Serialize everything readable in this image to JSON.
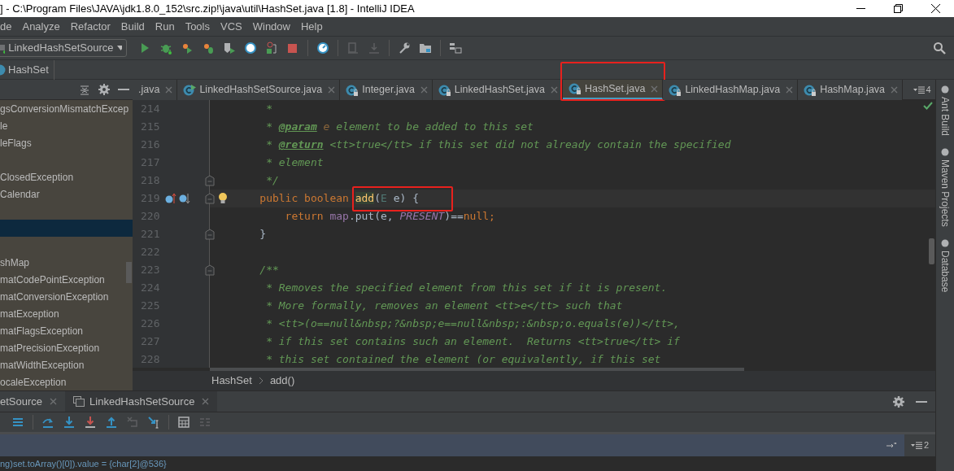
{
  "window": {
    "title": "] - C:\\Program Files\\JAVA\\jdk1.8.0_152\\src.zip!\\java\\util\\HashSet.java [1.8] - IntelliJ IDEA"
  },
  "menu": [
    "de",
    "Analyze",
    "Refactor",
    "Build",
    "Run",
    "Tools",
    "VCS",
    "Window",
    "Help"
  ],
  "run_config": {
    "value": "LinkedHashSetSource"
  },
  "nav_bar": {
    "class_name": "HashSet"
  },
  "project_tree": {
    "items": [
      {
        "label": "gsConversionMismatchExcep",
        "selected": false
      },
      {
        "label": "le",
        "selected": false
      },
      {
        "label": "leFlags",
        "selected": false
      },
      {
        "selected": false
      },
      {
        "label": "ClosedException",
        "selected": false
      },
      {
        "label": "Calendar",
        "selected": false
      },
      {
        "selected": false
      },
      {
        "selected": true
      },
      {
        "selected": false
      },
      {
        "label": "shMap",
        "selected": false
      },
      {
        "label": "matCodePointException",
        "selected": false
      },
      {
        "label": "matConversionException",
        "selected": false
      },
      {
        "label": "matException",
        "selected": false
      },
      {
        "label": "matFlagsException",
        "selected": false
      },
      {
        "label": "matPrecisionException",
        "selected": false
      },
      {
        "label": "matWidthException",
        "selected": false
      },
      {
        "label": "ocaleException",
        "selected": false
      }
    ]
  },
  "editor": {
    "tabs": [
      {
        "label": ".java",
        "selected": false,
        "framed": false
      },
      {
        "label": "LinkedHashSetSource.java",
        "kind": "runnable",
        "selected": false,
        "framed": false
      },
      {
        "label": "Integer.java",
        "kind": "library",
        "selected": false,
        "framed": false
      },
      {
        "label": "LinkedHashSet.java",
        "kind": "library",
        "selected": false,
        "framed": false
      },
      {
        "label": "HashSet.java",
        "kind": "library",
        "selected": true,
        "framed": true
      },
      {
        "label": "LinkedHashMap.java",
        "kind": "library",
        "selected": false,
        "framed": false
      },
      {
        "label": "HashMap.java",
        "kind": "library",
        "selected": false,
        "framed": false
      }
    ],
    "hidden_tab_count": "4",
    "lines": [
      {
        "number": "214",
        "fold": false,
        "current": false,
        "overrides": false,
        "tokens": [
          {
            "kind": "comment",
            "text": "     *"
          }
        ]
      },
      {
        "number": "215",
        "fold": false,
        "current": false,
        "overrides": false,
        "tokens": [
          {
            "kind": "comment",
            "text": "     * "
          },
          {
            "kind": "doctag",
            "text": "@param"
          },
          {
            "kind": "docparam",
            "text": " e"
          },
          {
            "kind": "comment",
            "text": " element to be added to this set"
          }
        ]
      },
      {
        "number": "216",
        "fold": false,
        "current": false,
        "overrides": false,
        "tokens": [
          {
            "kind": "comment",
            "text": "     * "
          },
          {
            "kind": "doctag",
            "text": "@return"
          },
          {
            "kind": "comment",
            "text": " <tt>true</tt> if this set did not already contain the specified"
          }
        ]
      },
      {
        "number": "217",
        "fold": false,
        "current": false,
        "overrides": false,
        "tokens": [
          {
            "kind": "comment",
            "text": "     * element"
          }
        ]
      },
      {
        "number": "218",
        "fold": true,
        "current": false,
        "overrides": false,
        "tokens": [
          {
            "kind": "comment",
            "text": "     */"
          }
        ]
      },
      {
        "number": "219",
        "fold": true,
        "current": true,
        "overrides": true,
        "tokens": [
          {
            "kind": "keyword",
            "text": "    public boolean "
          }
        ],
        "framed_tokens": [
          {
            "kind": "method",
            "text": "add"
          },
          {
            "kind": "plain",
            "text": "("
          },
          {
            "kind": "type",
            "text": "E"
          },
          {
            "kind": "plain",
            "text": " e) {"
          }
        ]
      },
      {
        "number": "220",
        "fold": false,
        "current": false,
        "overrides": false,
        "tokens": [
          {
            "kind": "keyword",
            "text": "        return "
          },
          {
            "kind": "field",
            "text": "map"
          },
          {
            "kind": "plain",
            "text": ".put(e, "
          },
          {
            "kind": "static",
            "text": "PRESENT"
          },
          {
            "kind": "plain",
            "text": ")=="
          },
          {
            "kind": "keyword",
            "text": "null;"
          }
        ]
      },
      {
        "number": "221",
        "fold": true,
        "current": false,
        "overrides": false,
        "tokens": [
          {
            "kind": "plain",
            "text": "    }"
          }
        ]
      },
      {
        "number": "222",
        "fold": false,
        "current": false,
        "overrides": false
      },
      {
        "number": "223",
        "fold": true,
        "current": false,
        "overrides": false,
        "tokens": [
          {
            "kind": "comment",
            "text": "    /**"
          }
        ]
      },
      {
        "number": "224",
        "fold": false,
        "current": false,
        "overrides": false,
        "tokens": [
          {
            "kind": "comment",
            "text": "     * Removes the specified element from this set if it is present."
          }
        ]
      },
      {
        "number": "225",
        "fold": false,
        "current": false,
        "overrides": false,
        "tokens": [
          {
            "kind": "comment",
            "text": "     * More formally, removes an element <tt>e</tt> such that"
          }
        ]
      },
      {
        "number": "226",
        "fold": false,
        "current": false,
        "overrides": false,
        "tokens": [
          {
            "kind": "comment",
            "text": "     * <tt>(o==null&nbsp;?&nbsp;e==null&nbsp;:&nbsp;o.equals(e))</tt>,"
          }
        ]
      },
      {
        "number": "227",
        "fold": false,
        "current": false,
        "overrides": false,
        "tokens": [
          {
            "kind": "comment",
            "text": "     * if this set contains such an element.  Returns <tt>true</tt> if"
          }
        ]
      },
      {
        "number": "228",
        "fold": false,
        "current": false,
        "overrides": false,
        "tokens": [
          {
            "kind": "comment",
            "text": "     * this set contained the element (or equivalently, if this set"
          }
        ]
      }
    ],
    "breadcrumb": [
      "HashSet",
      "add()"
    ]
  },
  "tool_strip": [
    "Ant Build",
    "Maven Projects",
    "Database"
  ],
  "debug": {
    "tabs": [
      {
        "label": "etSource",
        "selected": true
      },
      {
        "label": "LinkedHashSetSource",
        "selected": false
      }
    ],
    "frame_count": "2",
    "variable": "ng)set.toArray()[0]).value = {char[2]@536}"
  }
}
